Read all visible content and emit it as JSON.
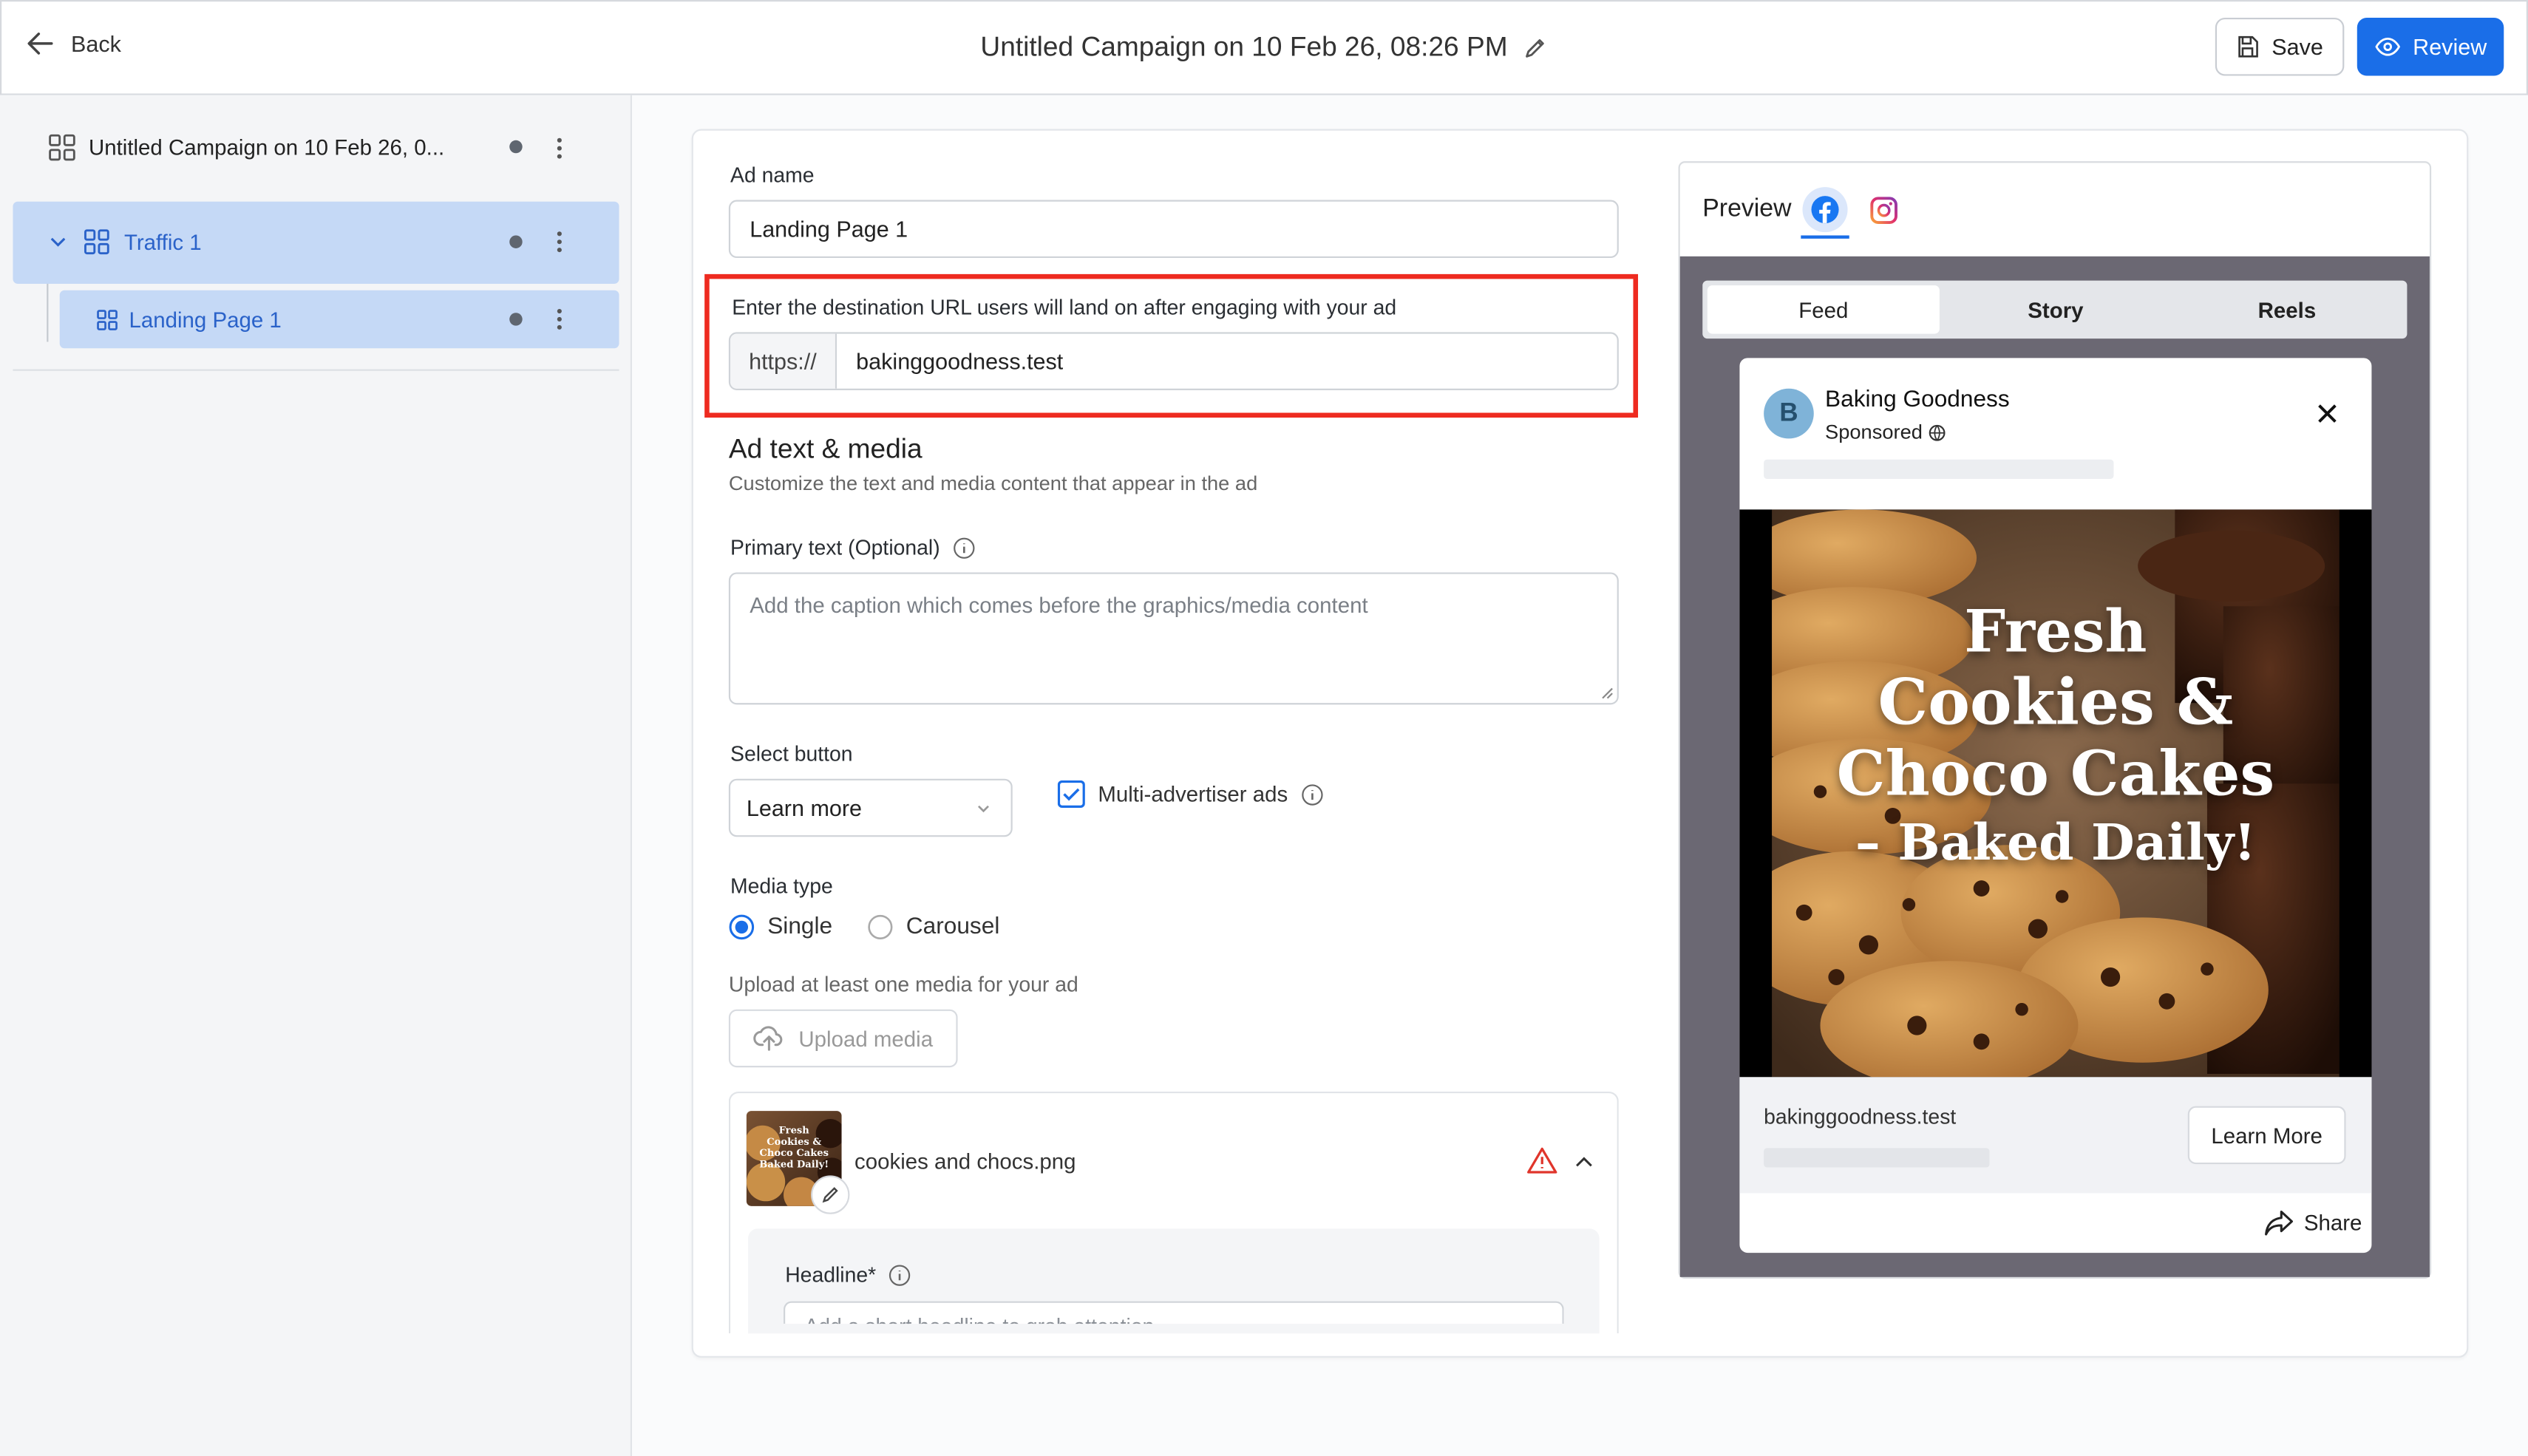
{
  "header": {
    "back_label": "Back",
    "campaign_title": "Untitled Campaign on 10 Feb 26, 08:26 PM",
    "save_label": "Save",
    "review_label": "Review"
  },
  "sidebar": {
    "campaign_item": "Untitled Campaign on 10 Feb 26, 0...",
    "adset_item": "Traffic 1",
    "ad_item": "Landing Page 1"
  },
  "form": {
    "ad_name_label": "Ad name",
    "ad_name_value": "Landing Page 1",
    "url_label": "Enter the destination URL users will land on after engaging with your ad",
    "url_prefix": "https://",
    "url_value": "bakinggoodness.test",
    "section_title": "Ad text & media",
    "section_subtitle": "Customize the text and media content that appear in the ad",
    "primary_text_label": "Primary text (Optional)",
    "primary_text_placeholder": "Add the caption which comes before the graphics/media content",
    "select_button_label": "Select button",
    "select_button_value": "Learn more",
    "multi_advertiser_label": "Multi-advertiser ads",
    "multi_advertiser_checked": true,
    "media_type_label": "Media type",
    "media_options": [
      "Single",
      "Carousel"
    ],
    "media_selected": "Single",
    "upload_hint": "Upload at least one media for your ad",
    "upload_button": "Upload media",
    "media_file_name": "cookies and chocs.png",
    "headline_label": "Headline*",
    "headline_placeholder": "Add a short headline to grab attention"
  },
  "preview": {
    "title": "Preview",
    "platforms": [
      "facebook-icon",
      "instagram-icon"
    ],
    "tabs": [
      "Feed",
      "Story",
      "Reels"
    ],
    "active_tab": "Feed",
    "page_name": "Baking Goodness",
    "avatar_letter": "B",
    "sponsored_label": "Sponsored",
    "image_text_lines": [
      "Fresh",
      "Cookies &",
      "Choco Cakes",
      "– Baked Daily!"
    ],
    "link_domain": "bakinggoodness.test",
    "cta_label": "Learn More",
    "share_label": "Share"
  },
  "thumbnail_text": [
    "Fresh",
    "Cookies &",
    "Choco Cakes",
    "Baked Daily!"
  ],
  "colors": {
    "accent": "#1a6ee8",
    "highlight_border": "#ee2b20",
    "sidebar_selected": "#c5d9f6",
    "warning": "#e0352b"
  }
}
